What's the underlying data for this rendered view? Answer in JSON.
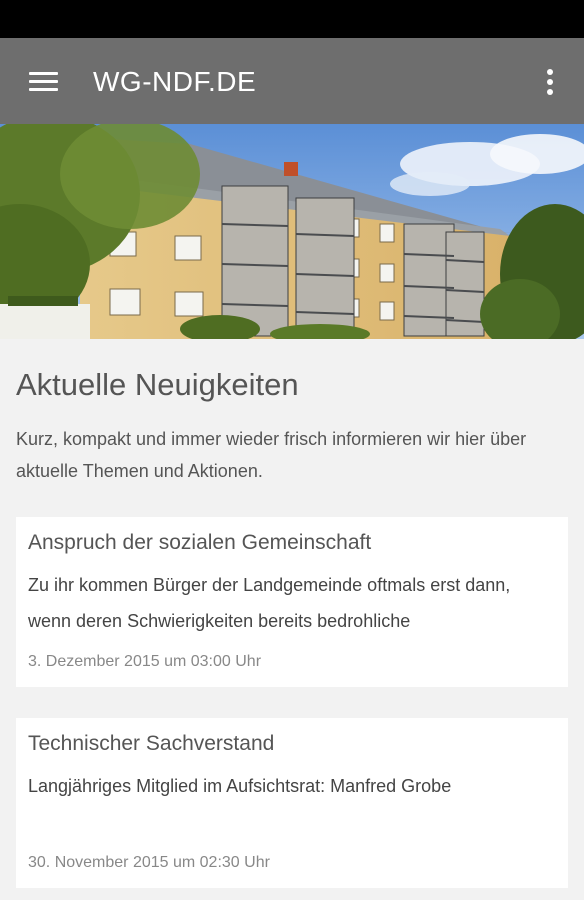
{
  "app_bar": {
    "title": "WG-NDF.DE",
    "menu_icon": "hamburger-menu-icon",
    "overflow_icon": "more-vert-icon",
    "background": "#6e6e6e"
  },
  "hero": {
    "image_description_icon": "apartment-building-photo"
  },
  "main": {
    "title": "Aktuelle Neuigkeiten",
    "intro": "Kurz, kompakt und immer wieder frisch informieren wir hier über aktuelle Themen und Aktionen."
  },
  "news": [
    {
      "title": "Anspruch der sozialen Gemeinschaft",
      "excerpt": "Zu ihr kommen Bürger der Landgemeinde oftmals erst dann, wenn deren Schwierigkeiten bereits bedrohliche",
      "date": "3. Dezember 2015 um 03:00 Uhr"
    },
    {
      "title": "Technischer Sachverstand",
      "excerpt": "Langjähriges Mitglied im Aufsichtsrat: Manfred Grobe",
      "date": "30. November 2015 um 02:30 Uhr"
    }
  ]
}
